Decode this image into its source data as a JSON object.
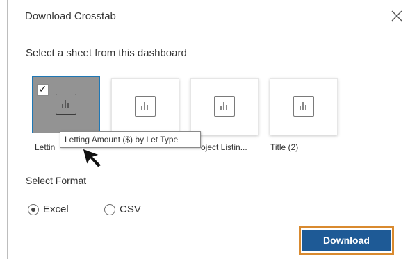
{
  "dialog": {
    "title": "Download Crosstab",
    "close_icon": "close-icon"
  },
  "sheets_section": {
    "heading": "Select a sheet from this dashboard",
    "sheets": [
      {
        "label": "Lettin",
        "selected": true,
        "icon": "bar-chart-icon"
      },
      {
        "label": "",
        "selected": false,
        "icon": "bar-chart-icon"
      },
      {
        "label": "oject Listin...",
        "selected": false,
        "icon": "bar-chart-icon"
      },
      {
        "label": "Title (2)",
        "selected": false,
        "icon": "bar-chart-icon"
      }
    ],
    "tooltip": "Letting Amount ($) by Let Type"
  },
  "format_section": {
    "heading": "Select Format",
    "options": [
      {
        "label": "Excel",
        "checked": true
      },
      {
        "label": "CSV",
        "checked": false
      }
    ]
  },
  "actions": {
    "download_label": "Download"
  },
  "colors": {
    "primary_button": "#1e5a96",
    "highlight_border": "#d98a2f",
    "selected_card": "#939393"
  }
}
